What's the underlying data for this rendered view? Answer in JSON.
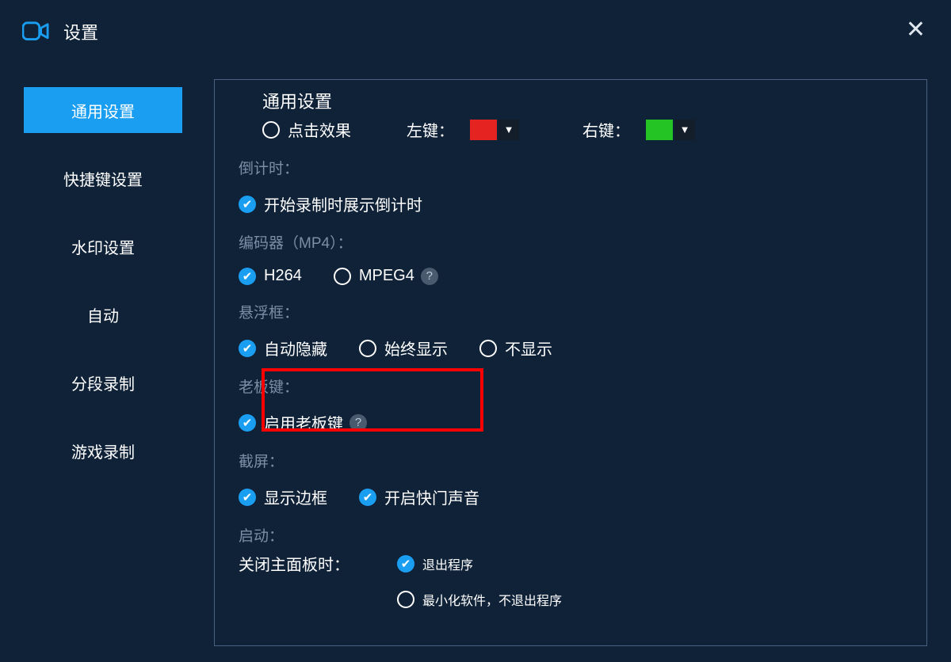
{
  "titlebar": {
    "title": "设置"
  },
  "sidebar": {
    "items": [
      {
        "label": "通用设置",
        "active": true
      },
      {
        "label": "快捷键设置",
        "active": false
      },
      {
        "label": "水印设置",
        "active": false
      },
      {
        "label": "自动",
        "active": false
      },
      {
        "label": "分段录制",
        "active": false
      },
      {
        "label": "游戏录制",
        "active": false
      }
    ]
  },
  "main": {
    "heading": "通用设置",
    "click_effect": {
      "option_label": "点击效果",
      "left_label": "左键：",
      "left_color": "#e52320",
      "right_label": "右键：",
      "right_color": "#24c424"
    },
    "countdown": {
      "section_label": "倒计时：",
      "option_label": "开始录制时展示倒计时"
    },
    "encoder": {
      "section_label": "编码器（MP4）：",
      "h264": "H264",
      "mpeg4": "MPEG4"
    },
    "float_panel": {
      "section_label": "悬浮框：",
      "auto_hide": "自动隐藏",
      "always_show": "始终显示",
      "never_show": "不显示"
    },
    "boss_key": {
      "section_label": "老板键：",
      "option_label": "启用老板键"
    },
    "screenshot": {
      "section_label": "截屏：",
      "show_border": "显示边框",
      "shutter_sound": "开启快门声音"
    },
    "startup": {
      "section_label": "启动：",
      "close_label": "关闭主面板时：",
      "exit": "退出程序",
      "minimize": "最小化软件，不退出程序"
    }
  }
}
